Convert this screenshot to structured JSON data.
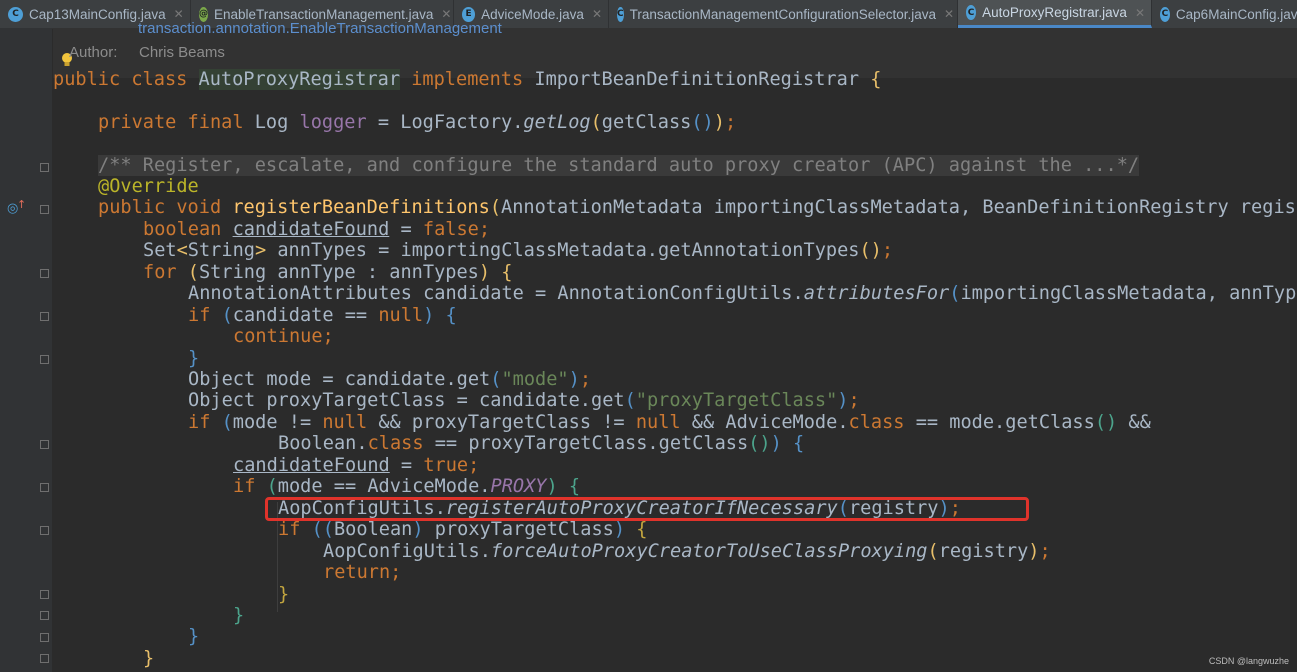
{
  "tabs": [
    {
      "label": "Cap13MainConfig.java",
      "icon": "class-icon",
      "icon_letter": "C",
      "icon_color": "#4e9fd6",
      "active": false
    },
    {
      "label": "EnableTransactionManagement.java",
      "icon": "annotation-icon",
      "icon_letter": "@",
      "icon_color": "#7ba84a",
      "active": false
    },
    {
      "label": "AdviceMode.java",
      "icon": "enum-icon",
      "icon_letter": "E",
      "icon_color": "#4e9fd6",
      "active": false
    },
    {
      "label": "TransactionManagementConfigurationSelector.java",
      "icon": "class-icon",
      "icon_letter": "C",
      "icon_color": "#4e9fd6",
      "active": false
    },
    {
      "label": "AutoProxyRegistrar.java",
      "icon": "class-icon",
      "icon_letter": "C",
      "icon_color": "#4e9fd6",
      "active": true
    },
    {
      "label": "Cap6MainConfig.java",
      "icon": "class-icon",
      "icon_letter": "C",
      "icon_color": "#4e9fd6",
      "active": false
    }
  ],
  "close_glyph": "✕",
  "doc": {
    "partial_line": "transaction.annotation.EnableTransactionManagement",
    "author_label": "Author:",
    "author_name": "Chris Beams"
  },
  "code": {
    "l1": {
      "a": "public class ",
      "b": "AutoProxyRegistrar",
      "c": " implements ",
      "d": "ImportBeanDefinitionRegistrar ",
      "e": "{"
    },
    "l2": {
      "a": "private final ",
      "b": "Log ",
      "c": "logger",
      "d": " = LogFactory.",
      "e": "getLog",
      "f": "(",
      "g": "getClass",
      "h": "()",
      "i": ")",
      "j": ";"
    },
    "l3": "/** Register, escalate, and configure the standard auto proxy creator (APC) against the ...*/",
    "l4": "@Override",
    "l5": {
      "a": "public void ",
      "b": "registerBeanDefinitions",
      "c": "(",
      "d": "AnnotationMetadata importingClassMetadata, BeanDefinitionRegistry regist"
    },
    "l6": {
      "a": "boolean ",
      "b": "candidateFound",
      "c": " = ",
      "d": "false",
      "e": ";"
    },
    "l7": {
      "a": "Set",
      "b": "<",
      "c": "String",
      "d": ">",
      "e": " annTypes = importingClassMetadata.getAnnotationTypes",
      "f": "()",
      "g": ";"
    },
    "l8": {
      "a": "for ",
      "b": "(",
      "c": "String annType : annTypes",
      "d": ")",
      "e": " {"
    },
    "l9": {
      "a": "AnnotationAttributes candidate = AnnotationConfigUtils.",
      "b": "attributesFor",
      "c": "(",
      "d": "importingClassMetadata, annType"
    },
    "l10": {
      "a": "if ",
      "b": "(",
      "c": "candidate == ",
      "d": "null",
      "e": ")",
      "f": " {"
    },
    "l11": "continue;",
    "l12": "}",
    "l13": {
      "a": "Object mode = candidate.get",
      "b": "(",
      "c": "\"mode\"",
      "d": ")",
      "e": ";"
    },
    "l14": {
      "a": "Object proxyTargetClass = candidate.get",
      "b": "(",
      "c": "\"proxyTargetClass\"",
      "d": ")",
      "e": ";"
    },
    "l15": {
      "a": "if ",
      "b": "(",
      "c": "mode != ",
      "d": "null",
      "e": " && proxyTargetClass != ",
      "f": "null",
      "g": " && AdviceMode.",
      "h": "class",
      "i": " == mode.getClass",
      "j": "()",
      "k": " &&"
    },
    "l16": {
      "a": "Boolean.",
      "b": "class",
      "c": " == proxyTargetClass.getClass",
      "d": "()",
      "e": ")",
      "f": " {"
    },
    "l17": {
      "a": "candidateFound",
      "b": " = ",
      "c": "true",
      "d": ";"
    },
    "l18": {
      "a": "if ",
      "b": "(",
      "c": "mode == AdviceMode.",
      "d": "PROXY",
      "e": ")",
      "f": " {"
    },
    "l19": {
      "a": "AopConfigUtils.",
      "b": "registerAutoProxyCreatorIfNecessary",
      "c": "(",
      "d": "registry",
      "e": ")",
      "f": ";"
    },
    "l20": {
      "a": "if ",
      "b": "((",
      "c": "Boolean",
      "d": ")",
      "e": " proxyTargetClass",
      "f": ")",
      "g": " {"
    },
    "l21": {
      "a": "AopConfigUtils.",
      "b": "forceAutoProxyCreatorToUseClassProxying",
      "c": "(",
      "d": "registry",
      "e": ")",
      "f": ";"
    },
    "l22": "return;",
    "l23": "}",
    "l24": "}",
    "l25": "}",
    "l26": "}"
  },
  "gutter_icons": [
    "bulb-icon",
    "override-method-icon"
  ],
  "highlight_color": "#e0332b",
  "watermark": "CSDN @langwuzhe"
}
